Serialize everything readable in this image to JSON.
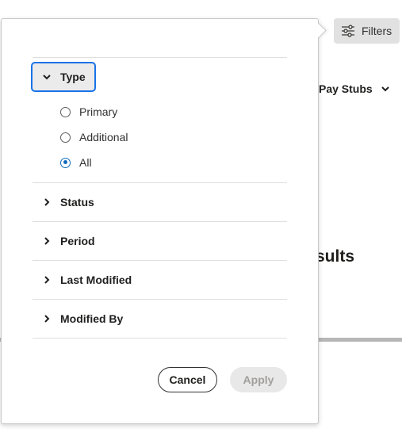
{
  "background": {
    "filters_button": {
      "label": "Filters",
      "icon": "sliders-icon"
    },
    "category_selector": {
      "label": "Pay Stubs",
      "icon": "chevron-down-icon"
    },
    "results_heading_fragment": "sults"
  },
  "filter_panel": {
    "type_section": {
      "label": "Type",
      "expanded": true,
      "options": [
        {
          "label": "Primary",
          "checked": false
        },
        {
          "label": "Additional",
          "checked": false
        },
        {
          "label": "All",
          "checked": true
        }
      ]
    },
    "sections": [
      {
        "label": "Status"
      },
      {
        "label": "Period"
      },
      {
        "label": "Last Modified"
      },
      {
        "label": "Modified By"
      }
    ],
    "actions": {
      "cancel_label": "Cancel",
      "apply_label": "Apply",
      "apply_disabled": true
    }
  },
  "colors": {
    "accent": "#0f6cbd",
    "focus_ring": "#1a73e8",
    "disabled_text": "#a19f9d"
  }
}
